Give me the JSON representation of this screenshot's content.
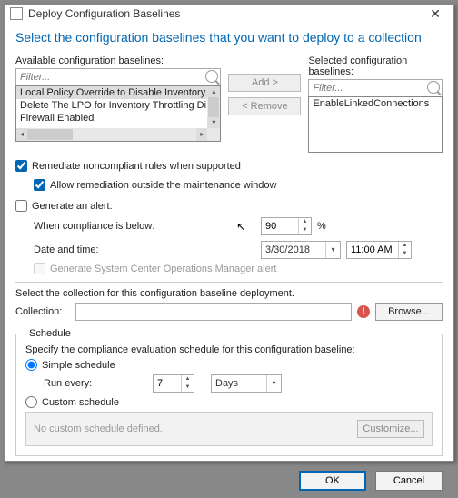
{
  "window": {
    "title": "Deploy Configuration Baselines"
  },
  "headline": "Select the configuration baselines that you want to deploy to a collection",
  "available": {
    "label": "Available configuration baselines:",
    "filter_placeholder": "Filter...",
    "items": [
      "Local Policy Override to Disable Inventory ...",
      "Delete The LPO for Inventory Throttling Di...",
      "Firewall Enabled"
    ]
  },
  "selected": {
    "label": "Selected configuration baselines:",
    "filter_placeholder": "Filter...",
    "items": [
      "EnableLinkedConnections"
    ]
  },
  "buttons": {
    "add": "Add >",
    "remove": "< Remove"
  },
  "remediate": {
    "label": "Remediate noncompliant rules when supported",
    "outside_label": "Allow remediation outside the maintenance window"
  },
  "alert": {
    "generate_label": "Generate an alert:",
    "when_label": "When compliance is below:",
    "when_value": "90",
    "when_unit": "%",
    "date_label": "Date and time:",
    "date_value": "3/30/2018",
    "time_value": "11:00 AM",
    "scom_label": "Generate System Center Operations Manager alert"
  },
  "collection": {
    "prompt": "Select the collection for this configuration baseline deployment.",
    "label": "Collection:",
    "browse": "Browse..."
  },
  "schedule": {
    "legend": "Schedule",
    "prompt": "Specify the compliance evaluation schedule for this configuration baseline:",
    "simple_label": "Simple schedule",
    "run_every_label": "Run every:",
    "run_every_value": "7",
    "run_every_unit": "Days",
    "custom_label": "Custom schedule",
    "no_custom": "No custom schedule defined.",
    "customize": "Customize..."
  },
  "footer": {
    "ok": "OK",
    "cancel": "Cancel"
  }
}
